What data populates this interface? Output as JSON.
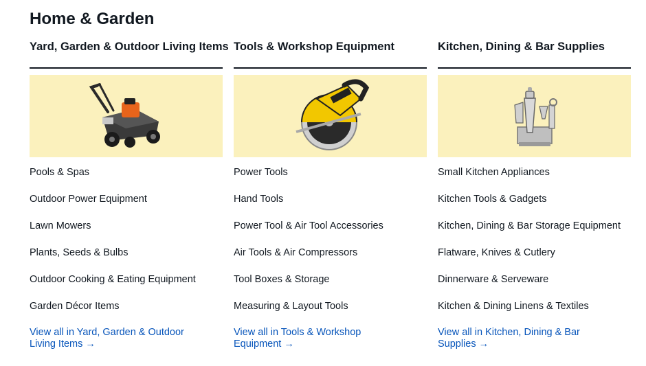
{
  "page": {
    "title": "Home & Garden"
  },
  "columns": [
    {
      "title": "Yard, Garden & Outdoor Living Items",
      "image_icon": "lawn-mower",
      "links": [
        "Pools & Spas",
        "Outdoor Power Equipment",
        "Lawn Mowers",
        "Plants, Seeds & Bulbs",
        "Outdoor Cooking & Eating Equipment",
        "Garden Décor Items"
      ],
      "view_all": "View all in Yard, Garden & Outdoor Living Items →"
    },
    {
      "title": "Tools & Workshop Equipment",
      "image_icon": "circular-saw",
      "links": [
        "Power Tools",
        "Hand Tools",
        "Power Tool & Air Tool Accessories",
        "Air Tools & Air Compressors",
        "Tool Boxes & Storage",
        "Measuring & Layout Tools"
      ],
      "view_all": "View all in Tools & Workshop Equipment →"
    },
    {
      "title": "Kitchen, Dining & Bar Supplies",
      "image_icon": "cocktail-shaker-set",
      "links": [
        "Small Kitchen Appliances",
        "Kitchen Tools & Gadgets",
        "Kitchen, Dining & Bar Storage Equipment",
        "Flatware, Knives & Cutlery",
        "Dinnerware & Serveware",
        "Kitchen & Dining Linens & Textiles"
      ],
      "view_all": "View all in Kitchen, Dining & Bar Supplies →"
    }
  ],
  "colors": {
    "image_background": "#fbf1bd",
    "link_blue": "#0654ba",
    "text": "#111820"
  }
}
